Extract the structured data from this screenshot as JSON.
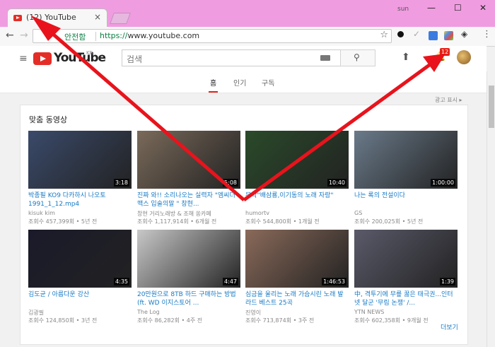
{
  "browser": {
    "tab_title": "(12) YouTube",
    "tab_close": "×",
    "user_label": "sun",
    "win_min": "—",
    "win_max": "☐",
    "win_close": "✕",
    "back": "←",
    "forward": "→",
    "secure_label": "안전함",
    "url_scheme": "https://",
    "url_host": "www.youtube.com",
    "star": "☆",
    "menu_dots": "⋮"
  },
  "youtube": {
    "menu_icon": "≡",
    "logo_text": "YouTube",
    "logo_region": "KR",
    "search_placeholder": "검색",
    "notification_count": "12",
    "tabs": [
      {
        "label": "홈"
      },
      {
        "label": "인기"
      },
      {
        "label": "구독"
      }
    ],
    "ad_label": "광고 표시 ▸",
    "section_title": "맞춤 동영상",
    "more_label": "더보기",
    "videos": [
      {
        "title": "박종필 KO9 다카하시 나오토 1991_1_12.mp4",
        "channel": "kisuk kim",
        "meta": "조회수 457,399회 • 5년 전",
        "duration": "3:18",
        "color": "#3a4a6a"
      },
      {
        "title": "진짜 와!! 소리나오는 실력자 \"엠씨더맥스 입술의말 \" 창현...",
        "channel": "창현 거리노래방 & 조해 쏭카페",
        "meta": "조회수 1,117,914회 • 6개월 전",
        "duration": "5:08",
        "color": "#7a6a5a"
      },
      {
        "title": "무박\"배삼룡,이기동의 노래 자랑\"",
        "channel": "humortv",
        "meta": "조회수 544,800회 • 1개월 전",
        "duration": "10:40",
        "color": "#2a4a2a"
      },
      {
        "title": "나는 록의 전설이다",
        "channel": "GS",
        "meta": "조회수 200,025회 • 5년 전",
        "duration": "1:00:00",
        "color": "#6a7a8a"
      },
      {
        "title": "김도균 / 아름다운 강산",
        "channel": "김광필",
        "meta": "조회수 124,850회 • 3년 전",
        "duration": "4:35",
        "color": "#1a1a2a"
      },
      {
        "title": "20만원으로 8TB 하드 구매하는 방법 (ft. WD 이지스토어 ...",
        "channel": "The Log",
        "meta": "조회수 86,282회 • 4주 전",
        "duration": "4:47",
        "color": "#c8c8c8"
      },
      {
        "title": "심금을 울리는 노래 가슴시린 노래 발라드 베스트 25곡",
        "channel": "진영이",
        "meta": "조회수 713,874회 • 3주 전",
        "duration": "1:46:53",
        "color": "#8a6a5a"
      },
      {
        "title": "中, 격투기에 무릎 꿇은 태극권...인터넷 달군 '무림 논쟁' /...",
        "channel": "YTN NEWS",
        "meta": "조회수 602,358회 • 9개월 전",
        "duration": "1:39",
        "color": "#5a5a6a"
      }
    ]
  },
  "colors": {
    "titlebar": "#f09ce0",
    "arrow": "#e8131c",
    "link": "#167ac6"
  }
}
